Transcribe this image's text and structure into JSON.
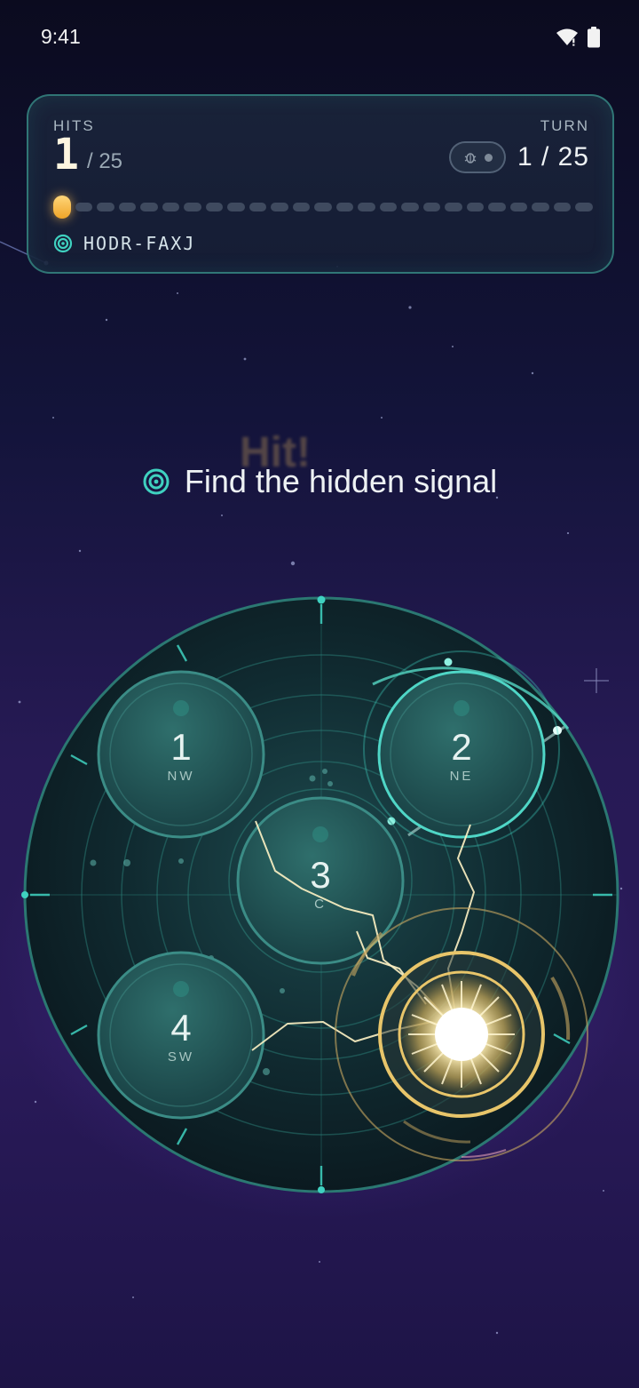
{
  "status_bar": {
    "time": "9:41",
    "icons": [
      "wifi-icon",
      "battery-icon"
    ]
  },
  "hud": {
    "hits_label": "HITS",
    "hits": "1",
    "hits_total": "/ 25",
    "turn_label": "TURN",
    "turn": "1 / 25",
    "progress": {
      "filled": 1,
      "total": 25
    },
    "debug_icon": "bug-icon",
    "code_icon": "signal-icon",
    "code": "HODR-FAXJ"
  },
  "ghost_text": "Hit!",
  "hint": {
    "icon": "target-icon",
    "text": "Find the hidden signal"
  },
  "zones": [
    {
      "number": "1",
      "label": "NW"
    },
    {
      "number": "2",
      "label": "NE"
    },
    {
      "number": "3",
      "label": "C"
    },
    {
      "number": "4",
      "label": "SW"
    }
  ],
  "colors": {
    "accent": "#3fd1c0",
    "hit": "#f2c96a",
    "bg_top": "#0b0b1f",
    "bg_bottom": "#2a1a5a"
  }
}
